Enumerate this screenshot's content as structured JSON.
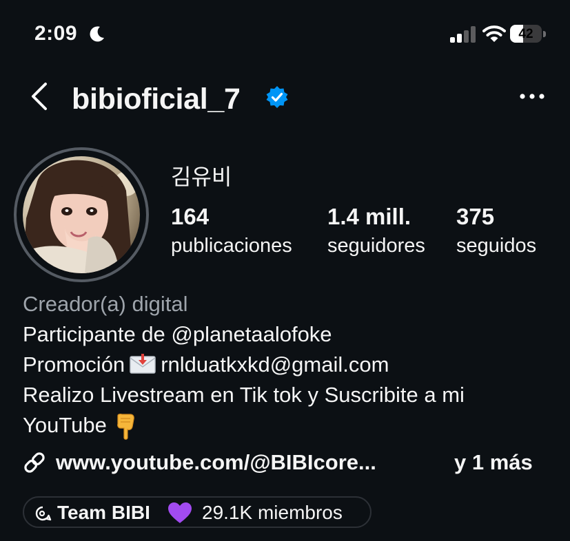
{
  "status_bar": {
    "time": "2:09",
    "battery": "42",
    "battery_level": 0.42
  },
  "header": {
    "username": "bibioficial_7",
    "verified_color": "#0095f6"
  },
  "profile": {
    "display_name": "김유비",
    "stats": [
      {
        "value": "164",
        "label": "publicaciones"
      },
      {
        "value": "1.4 mill.",
        "label": "seguidores"
      },
      {
        "value": "375",
        "label": "seguidos"
      }
    ]
  },
  "bio": {
    "category": "Creador(a) digital",
    "line1": "Participante de @planetaalofoke",
    "line2_prefix": "Promoción",
    "line2_email": "rnlduatkxkd@gmail.com",
    "line3": "Realizo Livestream en Tik tok y Suscribite a mi",
    "line4": "YouTube"
  },
  "links": {
    "url": "www.youtube.com/@BIBIcore...",
    "more": "y 1 más"
  },
  "channel": {
    "name": "Team BIBI",
    "members": "29.1K miembros",
    "heart_color": "#a24bf0"
  },
  "icons": {
    "moon": "moon-icon",
    "signal": "cellular-signal-icon",
    "wifi": "wifi-icon",
    "battery": "battery-icon",
    "back": "chevron-left-icon",
    "verified": "verified-badge-icon",
    "more": "more-options-icon",
    "envelope": "incoming-envelope-emoji",
    "hand": "backhand-pointing-down-emoji",
    "link": "link-icon",
    "channel": "broadcast-channel-icon",
    "heart": "purple-heart-emoji"
  }
}
